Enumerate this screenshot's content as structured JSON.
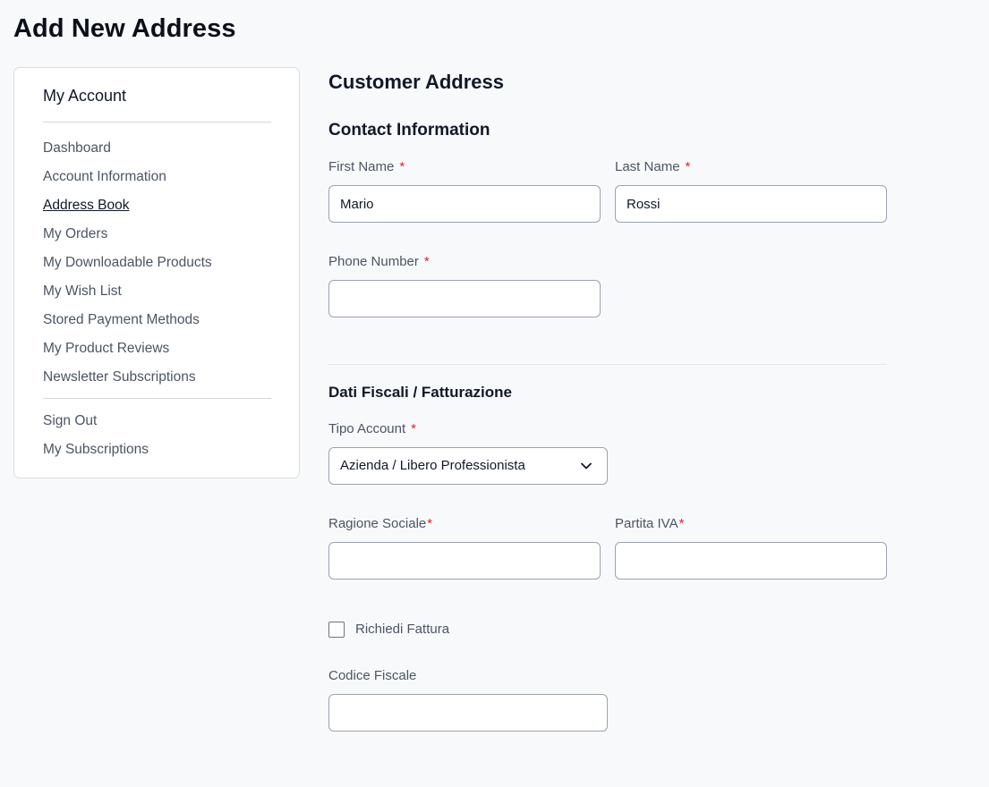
{
  "page": {
    "title": "Add New Address"
  },
  "sidebar": {
    "title": "My Account",
    "items": [
      {
        "label": "Dashboard"
      },
      {
        "label": "Account Information"
      },
      {
        "label": "Address Book",
        "active": true
      },
      {
        "label": "My Orders"
      },
      {
        "label": "My Downloadable Products"
      },
      {
        "label": "My Wish List"
      },
      {
        "label": "Stored Payment Methods"
      },
      {
        "label": "My Product Reviews"
      },
      {
        "label": "Newsletter Subscriptions"
      }
    ],
    "bottom_items": [
      {
        "label": "Sign Out"
      },
      {
        "label": "My Subscriptions"
      }
    ]
  },
  "form": {
    "heading": "Customer Address",
    "contact_heading": "Contact Information",
    "first_name": {
      "label": "First Name",
      "value": "Mario",
      "required": "*"
    },
    "last_name": {
      "label": "Last Name",
      "value": "Rossi",
      "required": "*"
    },
    "phone": {
      "label": "Phone Number",
      "value": "",
      "required": "*"
    },
    "fiscal_heading": "Dati Fiscali / Fatturazione",
    "tipo_account": {
      "label": "Tipo Account",
      "value": "Azienda / Libero Professionista",
      "required": "*"
    },
    "ragione_sociale": {
      "label": "Ragione Sociale",
      "value": "",
      "required": "*"
    },
    "partita_iva": {
      "label": "Partita IVA",
      "value": "",
      "required": "*"
    },
    "richiedi_fattura": {
      "label": "Richiedi Fattura",
      "checked": false
    },
    "codice_fiscale": {
      "label": "Codice Fiscale",
      "value": ""
    }
  },
  "colors": {
    "required": "#dc2626",
    "text_muted": "#4b5563",
    "border": "#9ca3af"
  }
}
